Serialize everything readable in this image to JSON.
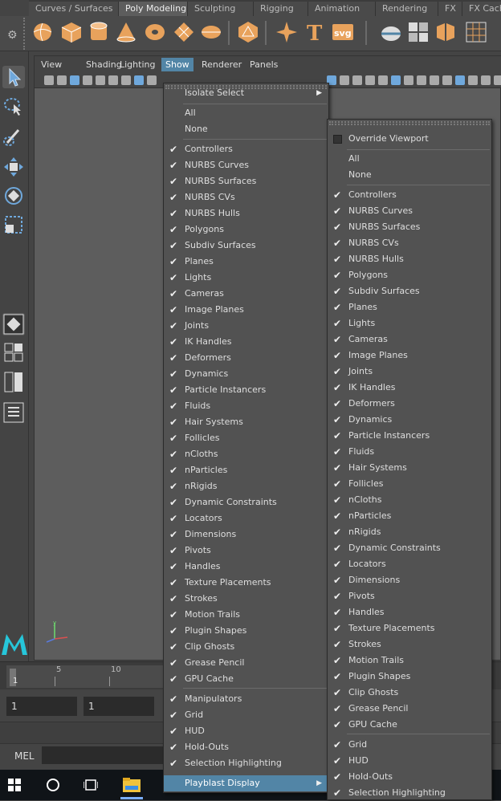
{
  "shelf_tabs": [
    "Curves / Surfaces",
    "Poly Modeling",
    "Sculpting",
    "Rigging",
    "Animation",
    "Rendering",
    "FX",
    "FX Cachi"
  ],
  "shelf_tab_active": "Poly Modeling",
  "shelf_icons": [
    "poly-sphere-icon",
    "poly-cube-icon",
    "poly-cylinder-icon",
    "poly-cone-icon",
    "poly-torus-icon",
    "poly-plane-icon",
    "poly-disc-icon",
    "platonic-solid-icon",
    "super-shape-icon",
    "type-icon",
    "svg-icon",
    "multi-cut-icon",
    "combine-icon",
    "extract-icon",
    "smooth-icon"
  ],
  "shelf_texts": {
    "type": "T",
    "svg": "svg"
  },
  "viewport_menus": [
    "View",
    "Shading",
    "Lighting",
    "Show",
    "Renderer",
    "Panels"
  ],
  "viewport_menu_active": "Show",
  "timeline": {
    "ticks": [
      "5",
      "10"
    ],
    "current": "1"
  },
  "range": {
    "start": "1",
    "start_anim": "1"
  },
  "cmd": {
    "label": "MEL"
  },
  "show_menu": {
    "isolate": "Isolate Select",
    "all": "All",
    "none": "None",
    "items": [
      "Controllers",
      "NURBS Curves",
      "NURBS Surfaces",
      "NURBS CVs",
      "NURBS Hulls",
      "Polygons",
      "Subdiv Surfaces",
      "Planes",
      "Lights",
      "Cameras",
      "Image Planes",
      "Joints",
      "IK Handles",
      "Deformers",
      "Dynamics",
      "Particle Instancers",
      "Fluids",
      "Hair Systems",
      "Follicles",
      "nCloths",
      "nParticles",
      "nRigids",
      "Dynamic Constraints",
      "Locators",
      "Dimensions",
      "Pivots",
      "Handles",
      "Texture Placements",
      "Strokes",
      "Motion Trails",
      "Plugin Shapes",
      "Clip Ghosts",
      "Grease Pencil",
      "GPU Cache"
    ],
    "items2": [
      "Manipulators",
      "Grid",
      "HUD",
      "Hold-Outs",
      "Selection Highlighting"
    ],
    "playblast": "Playblast Display",
    "check": "✔"
  },
  "playblast_menu": {
    "override": "Override Viewport",
    "all": "All",
    "none": "None",
    "items": [
      "Controllers",
      "NURBS Curves",
      "NURBS Surfaces",
      "NURBS CVs",
      "NURBS Hulls",
      "Polygons",
      "Subdiv Surfaces",
      "Planes",
      "Lights",
      "Cameras",
      "Image Planes",
      "Joints",
      "IK Handles",
      "Deformers",
      "Dynamics",
      "Particle Instancers",
      "Fluids",
      "Hair Systems",
      "Follicles",
      "nCloths",
      "nParticles",
      "nRigids",
      "Dynamic Constraints",
      "Locators",
      "Dimensions",
      "Pivots",
      "Handles",
      "Texture Placements",
      "Strokes",
      "Motion Trails",
      "Plugin Shapes",
      "Clip Ghosts",
      "Grease Pencil",
      "GPU Cache"
    ],
    "items2": [
      "Grid",
      "HUD",
      "Hold-Outs",
      "Selection Highlighting"
    ]
  },
  "colors": {
    "accent": "#5285a6",
    "shelf_icon": "#e8a25c"
  }
}
